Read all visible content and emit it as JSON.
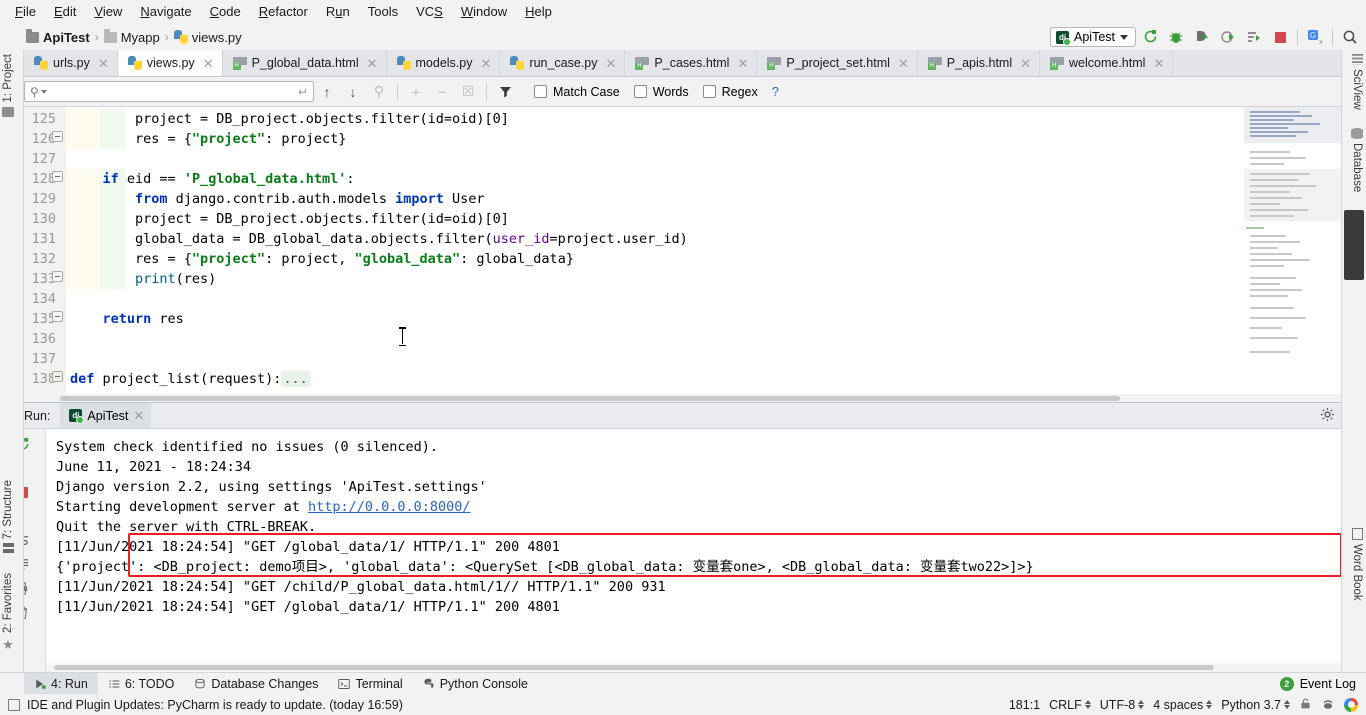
{
  "menu": {
    "items": [
      "File",
      "Edit",
      "View",
      "Navigate",
      "Code",
      "Refactor",
      "Run",
      "Tools",
      "VCS",
      "Window",
      "Help"
    ]
  },
  "breadcrumb": {
    "project": "ApiTest",
    "folder": "Myapp",
    "file": "views.py"
  },
  "toolbar": {
    "run_config": "ApiTest",
    "dj_badge": "dj",
    "icons": [
      "rerun-icon",
      "debug-icon",
      "run-icon",
      "profile-icon",
      "run-with-coverage-icon",
      "stop-icon",
      "translate-icon",
      "search-everywhere-icon"
    ]
  },
  "editor_tabs": [
    {
      "label": "urls.py",
      "type": "py",
      "active": false
    },
    {
      "label": "views.py",
      "type": "py",
      "active": true
    },
    {
      "label": "P_global_data.html",
      "type": "html",
      "active": false
    },
    {
      "label": "models.py",
      "type": "py",
      "active": false
    },
    {
      "label": "run_case.py",
      "type": "py",
      "active": false
    },
    {
      "label": "P_cases.html",
      "type": "html",
      "active": false
    },
    {
      "label": "P_project_set.html",
      "type": "html",
      "active": false
    },
    {
      "label": "P_apis.html",
      "type": "html",
      "active": false
    },
    {
      "label": "welcome.html",
      "type": "html",
      "active": false
    }
  ],
  "findbar": {
    "value": "",
    "placeholder": "",
    "match_case": "Match Case",
    "words": "Words",
    "regex": "Regex",
    "help": "?",
    "match_case_checked": false,
    "words_checked": false,
    "regex_checked": false
  },
  "editor": {
    "lines": [
      {
        "num": "125",
        "indent": 0,
        "highlight": true
      },
      {
        "num": "126",
        "indent": 0,
        "highlight": true,
        "fold": true
      },
      {
        "num": "127",
        "indent": 0,
        "highlight": false
      },
      {
        "num": "128",
        "indent": 0,
        "highlight": true,
        "fold": true
      },
      {
        "num": "129",
        "indent": 0,
        "highlight": true
      },
      {
        "num": "130",
        "indent": 0,
        "highlight": true
      },
      {
        "num": "131",
        "indent": 0,
        "highlight": true
      },
      {
        "num": "132",
        "indent": 0,
        "highlight": true
      },
      {
        "num": "133",
        "indent": 0,
        "highlight": true,
        "fold": true
      },
      {
        "num": "134",
        "indent": 0,
        "highlight": false
      },
      {
        "num": "135",
        "indent": 0,
        "highlight": false,
        "fold": true
      },
      {
        "num": "136",
        "indent": 0,
        "highlight": false
      },
      {
        "num": "137",
        "indent": 0,
        "highlight": false
      },
      {
        "num": "138",
        "indent": 0,
        "highlight": false
      }
    ],
    "code_text": {
      "l125": "project = DB_project.objects.filter(id=oid)[0]",
      "l126": "res = {\"project\": project}",
      "l128": "if eid == 'P_global_data.html':",
      "l129": "from django.contrib.auth.models import User",
      "l130": "project = DB_project.objects.filter(id=oid)[0]",
      "l131": "global_data = DB_global_data.objects.filter(user_id=project.user_id)",
      "l132": "res = {\"project\": project, \"global_data\": global_data}",
      "l133": "print(res)",
      "l135": "return res",
      "l138": "def project_list(request):..."
    }
  },
  "run_window": {
    "label": "Run:",
    "tab": "ApiTest",
    "console": [
      "System check identified no issues (0 silenced).",
      "June 11, 2021 - 18:24:34",
      "Django version 2.2, using settings 'ApiTest.settings'",
      "Starting development server at ",
      "Quit the server with CTRL-BREAK.",
      "[11/Jun/2021 18:24:54] \"GET /global_data/1/ HTTP/1.1\" 200 4801",
      "{'project': <DB_project: demo项目>, 'global_data': <QuerySet [<DB_global_data: 变量套one>, <DB_global_data: 变量套two22>]>}",
      "[11/Jun/2021 18:24:54] \"GET /child/P_global_data.html/1// HTTP/1.1\" 200 931",
      "[11/Jun/2021 18:24:54] \"GET /global_data/1/ HTTP/1.1\" 200 4801"
    ],
    "server_url": "http://0.0.0.0:8000/",
    "highlight_color": "#ee1c25"
  },
  "bottom_bar": {
    "items": [
      {
        "label": "4: Run",
        "icon": "run-icon",
        "active": true
      },
      {
        "label": "6: TODO",
        "icon": "todo-icon",
        "active": false
      },
      {
        "label": "Database Changes",
        "icon": "database-icon",
        "active": false
      },
      {
        "label": "Terminal",
        "icon": "terminal-icon",
        "active": false
      },
      {
        "label": "Python Console",
        "icon": "python-icon",
        "active": false
      }
    ],
    "event_log": "Event Log",
    "event_log_count": "2"
  },
  "status_bar": {
    "message": "IDE and Plugin Updates: PyCharm is ready to update. (today 16:59)",
    "position": "181:1",
    "line_separator": "CRLF",
    "encoding": "UTF-8",
    "indent": "4 spaces",
    "interpreter": "Python 3.7"
  },
  "left_sidebar": [
    {
      "label": "1: Project",
      "icon": "project-icon"
    },
    {
      "label": "7: Structure",
      "icon": "structure-icon"
    },
    {
      "label": "2: Favorites",
      "icon": "star-icon"
    }
  ],
  "right_sidebar": [
    {
      "label": "SciView",
      "icon": "grid-icon"
    },
    {
      "label": "Database",
      "icon": "database-icon"
    },
    {
      "label": "Word Book",
      "icon": "book-icon"
    }
  ]
}
